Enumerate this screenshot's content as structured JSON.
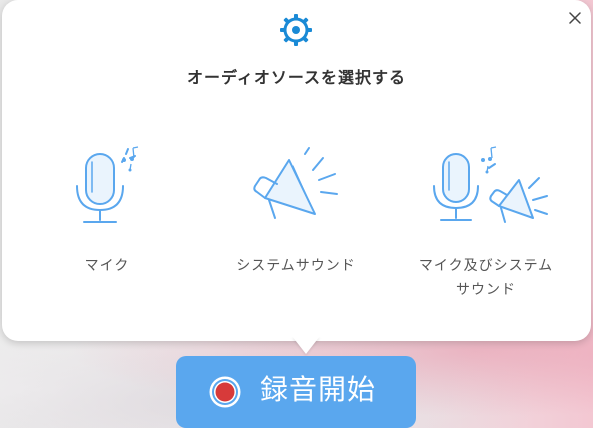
{
  "dialog": {
    "title": "オーディオソースを選択する",
    "settings_icon": "gear-icon",
    "close_icon": "close-icon"
  },
  "options": [
    {
      "label": "マイク",
      "icon": "microphone-icon"
    },
    {
      "label": "システムサウンド",
      "icon": "speaker-icon"
    },
    {
      "label_line1": "マイク及びシステム",
      "label_line2": "サウンド",
      "icon": "microphone-speaker-icon"
    }
  ],
  "record_button": {
    "label": "録音開始",
    "icon": "record-icon"
  },
  "colors": {
    "accent": "#1a8ad6",
    "icon_line": "#5aa7ee",
    "button": "#5aa7ee",
    "record_red": "#d73a3a"
  }
}
